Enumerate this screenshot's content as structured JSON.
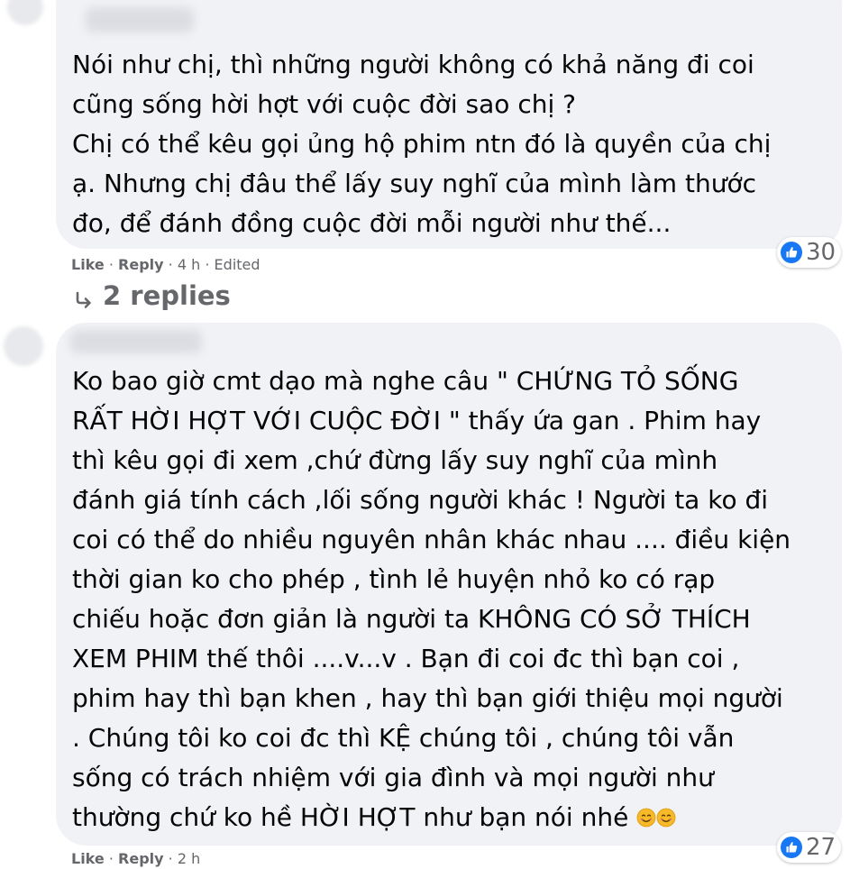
{
  "comments": [
    {
      "text_lines": [
        "Nói như chị, thì những người không có khả năng đi coi",
        "cũng sống hời hợt với cuộc đời sao chị ?",
        "Chị có thể kêu gọi ủng hộ phim ntn đó là quyền của chị",
        "ạ. Nhưng chị đâu thể lấy suy nghĩ của mình làm thước",
        "đo, để đánh đồng cuộc đời mỗi người như thế..."
      ],
      "like_label": "Like",
      "reply_label": "Reply",
      "sep": "·",
      "time": "4 h",
      "edited": "Edited",
      "reaction_count": "30",
      "replies_label": "2 replies"
    },
    {
      "text_lines": [
        "Ko bao giờ cmt dạo mà nghe câu \" CHỨNG TỎ SỐNG",
        "RẤT HỜI HỢT VỚI CUỘC ĐỜI \" thấy ứa gan . Phim hay",
        "thì kêu gọi đi xem ,chứ đừng lấy suy nghĩ của mình",
        "đánh giá tính cách ,lối sống người khác ! Người ta ko đi",
        "coi có thể do nhiều nguyên nhân khác nhau .... điều kiện",
        "thời gian ko cho phép , tình lẻ huyện nhỏ ko có rạp",
        "chiếu hoặc đơn giản là người ta KHÔNG CÓ SỞ THÍCH",
        "XEM PHIM thế thôi ....v...v . Bạn đi coi đc thì bạn coi ,",
        "phim hay thì bạn khen , hay thì bạn giới thiệu mọi người",
        ". Chúng tôi ko coi đc thì KỆ chúng tôi , chúng tôi vẫn",
        "sống có trách nhiệm với gia đình và mọi người như",
        "thường chứ ko hề HỜI HỢT như bạn nói nhé"
      ],
      "like_label": "Like",
      "reply_label": "Reply",
      "sep": "·",
      "time": "2 h",
      "reaction_count": "27"
    }
  ],
  "icons": {
    "like": "like-icon",
    "reply_arrow": "reply-arrow-icon",
    "emoji": "smiling-face-icon"
  },
  "colors": {
    "bubble": "#f0f2f5",
    "meta_text": "#65676b",
    "like_blue": "#1877f2"
  }
}
